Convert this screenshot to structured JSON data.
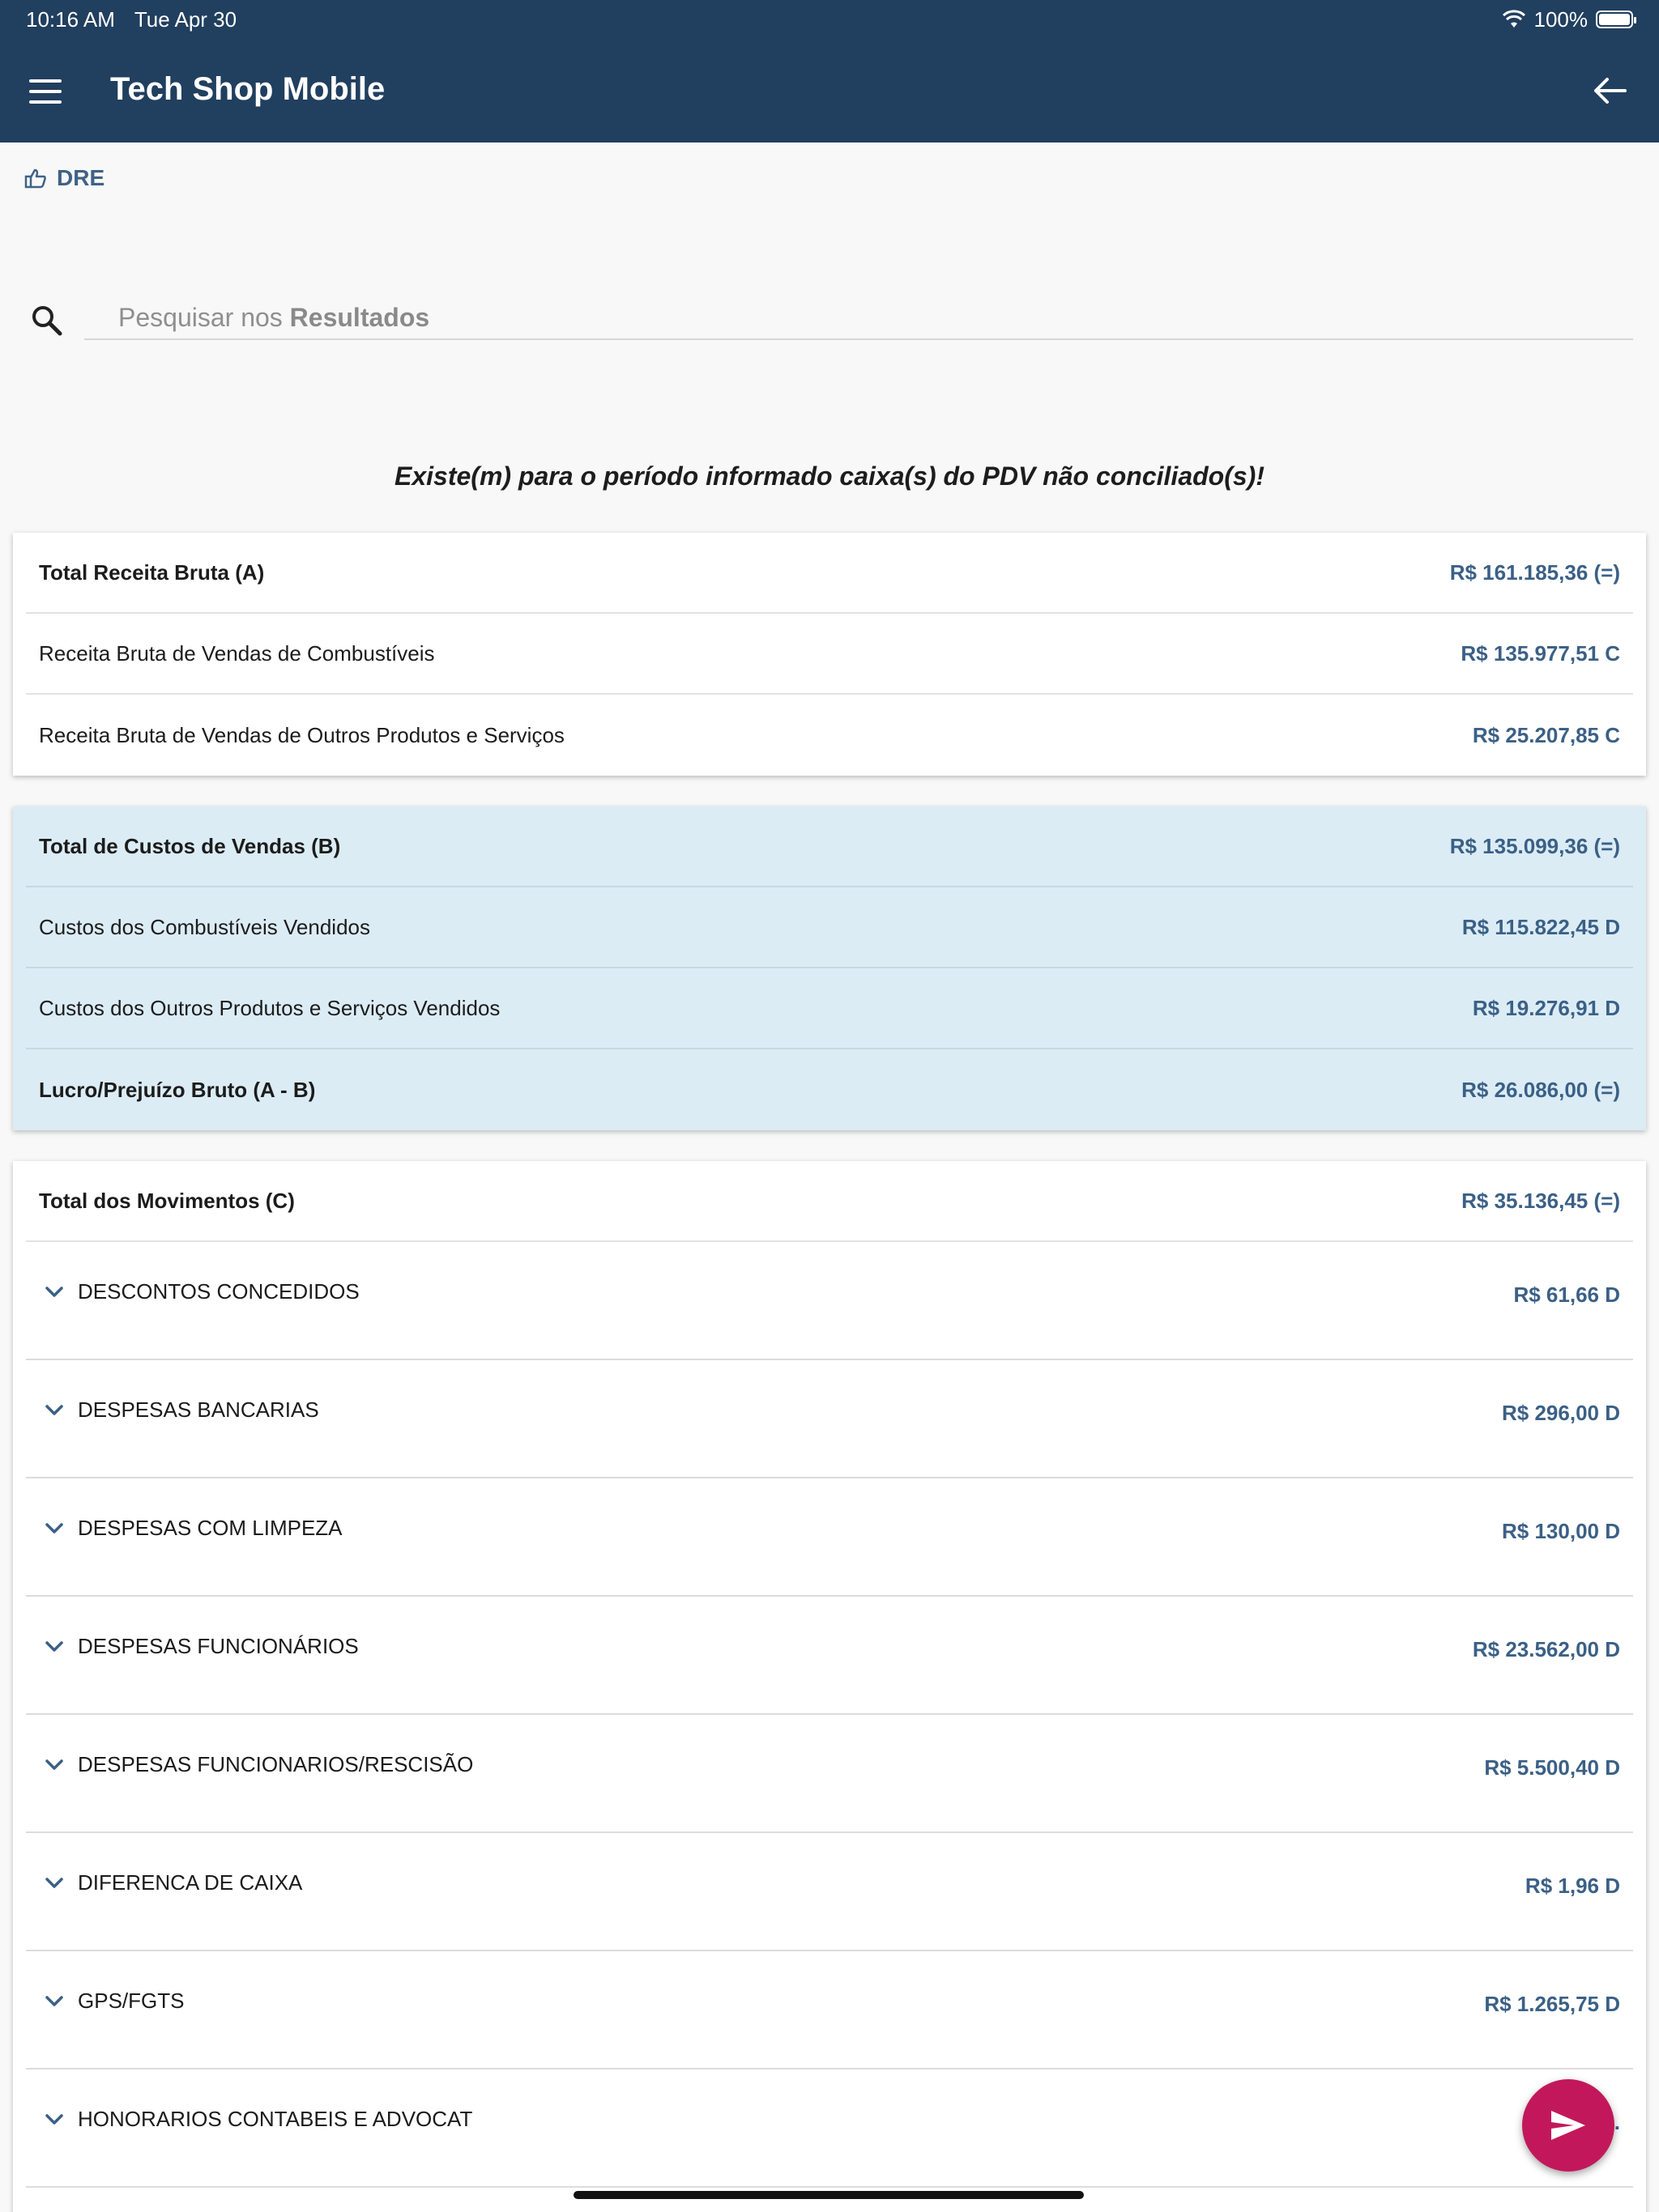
{
  "status_bar": {
    "time": "10:16 AM",
    "date": "Tue Apr 30",
    "battery": "100%"
  },
  "app": {
    "title": "Tech Shop Mobile"
  },
  "section": {
    "label": "DRE"
  },
  "search": {
    "placeholder_prefix": "Pesquisar nos ",
    "placeholder_bold": "Resultados"
  },
  "warning": "Existe(m) para o período informado caixa(s) do PDV não conciliado(s)!",
  "receita": [
    {
      "label": "Total Receita Bruta (A)",
      "value": "R$ 161.185,36 (=)"
    },
    {
      "label": "Receita Bruta de Vendas de Combustíveis",
      "value": "R$ 135.977,51 C"
    },
    {
      "label": "Receita Bruta de Vendas de Outros Produtos e Serviços",
      "value": "R$ 25.207,85 C"
    }
  ],
  "custos": [
    {
      "label": "Total de Custos de Vendas (B)",
      "value": "R$ 135.099,36 (=)"
    },
    {
      "label": "Custos dos Combustíveis Vendidos",
      "value": "R$ 115.822,45 D"
    },
    {
      "label": "Custos dos Outros Produtos e Serviços Vendidos",
      "value": "R$ 19.276,91 D"
    },
    {
      "label": "Lucro/Prejuízo Bruto (A - B)",
      "value": "R$ 26.086,00 (=)"
    }
  ],
  "movimentos": {
    "total": {
      "label": "Total dos Movimentos (C)",
      "value": "R$ 35.136,45 (=)"
    },
    "items": [
      {
        "label": "DESCONTOS CONCEDIDOS",
        "value": "R$ 61,66 D"
      },
      {
        "label": "DESPESAS BANCARIAS",
        "value": "R$ 296,00 D"
      },
      {
        "label": "DESPESAS COM LIMPEZA",
        "value": "R$ 130,00 D"
      },
      {
        "label": "DESPESAS FUNCIONÁRIOS",
        "value": "R$ 23.562,00 D"
      },
      {
        "label": "DESPESAS FUNCIONARIOS/RESCISÃO",
        "value": "R$ 5.500,40 D"
      },
      {
        "label": "DIFERENCA DE CAIXA",
        "value": "R$ 1,96 D"
      },
      {
        "label": "GPS/FGTS",
        "value": "R$ 1.265,75 D"
      },
      {
        "label": "HONORARIOS CONTABEIS E ADVOCAT",
        "value": "R$ 1..."
      }
    ]
  },
  "colors": {
    "appbar": "#213f5f",
    "value_text": "#3b6086",
    "fab": "#c2185b",
    "cost_card": "#dbecf5"
  }
}
